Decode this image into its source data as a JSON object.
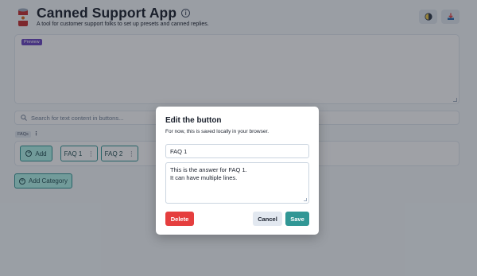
{
  "header": {
    "title": "Canned Support App",
    "subtitle": "A tool for customer support folks to set up presets and canned replies.",
    "info_icon": "info-circle-icon",
    "logo_icon": "soup-can-icon",
    "theme_icon": "contrast-icon",
    "download_icon": "download-icon"
  },
  "preview": {
    "badge": "Preview"
  },
  "search": {
    "placeholder": "Search for text content in buttons..."
  },
  "category": {
    "tag": "FAQs",
    "menu_glyph": "⋮",
    "add_button_label": "Add",
    "buttons": [
      {
        "label": "FAQ 1"
      },
      {
        "label": "FAQ 2"
      }
    ]
  },
  "add_category_label": "Add Category",
  "modal": {
    "title": "Edit the button",
    "description": "For now, this is saved locally in your browser.",
    "name_value": "FAQ 1",
    "content_value": "This is the answer for FAQ 1.\nIt can have multiple lines.",
    "delete_label": "Delete",
    "cancel_label": "Cancel",
    "save_label": "Save"
  },
  "colors": {
    "accent": "#319795",
    "accent_light": "#b2f5ea",
    "danger": "#e53e3e",
    "badge_purple": "#6b46c1"
  }
}
